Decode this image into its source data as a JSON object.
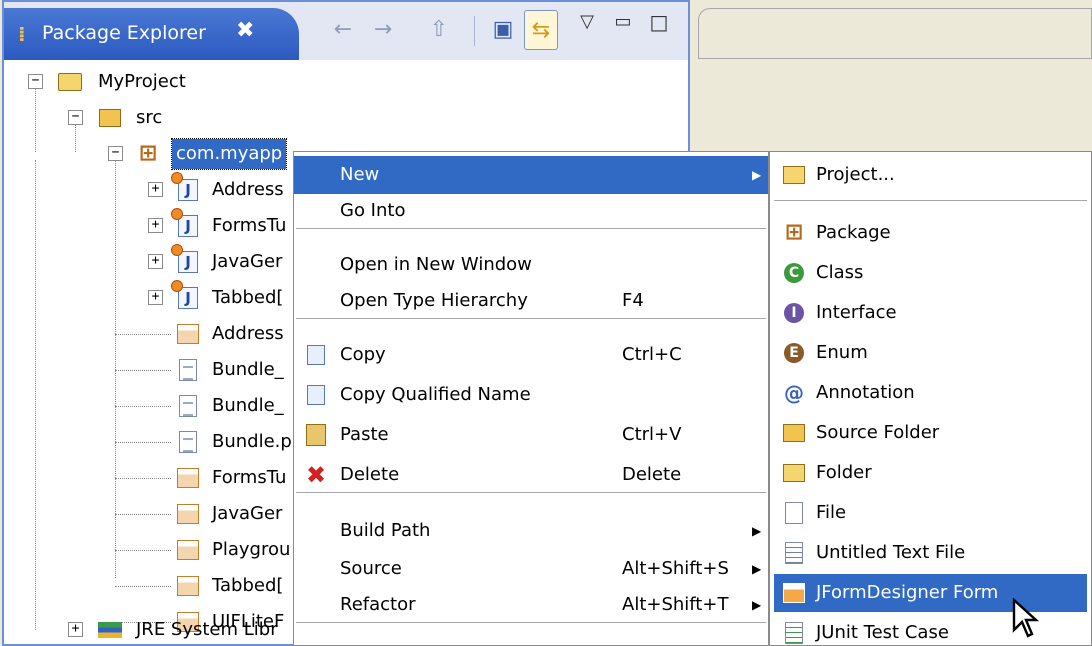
{
  "view": {
    "title": "Package Explorer",
    "close_glyph": "✖",
    "toolbar": {
      "back_icon": "←",
      "forward_icon": "→",
      "up_icon": "⇧",
      "collapse_icon": "▣",
      "link_icon": "⇆",
      "menu_icon": "▽",
      "minimize_icon": "▭",
      "maximize_icon": "□"
    }
  },
  "tree": {
    "project": "MyProject",
    "src": "src",
    "package": "com.myapp",
    "children": [
      {
        "label": "Address",
        "kind": "java",
        "expandable": true
      },
      {
        "label": "FormsTu",
        "kind": "java",
        "expandable": true
      },
      {
        "label": "JavaGer",
        "kind": "java",
        "expandable": true
      },
      {
        "label": "Tabbed[",
        "kind": "java",
        "expandable": true
      },
      {
        "label": "Address",
        "kind": "form",
        "expandable": false
      },
      {
        "label": "Bundle_",
        "kind": "file",
        "expandable": false
      },
      {
        "label": "Bundle_",
        "kind": "file",
        "expandable": false
      },
      {
        "label": "Bundle.p",
        "kind": "file",
        "expandable": false
      },
      {
        "label": "FormsTu",
        "kind": "form",
        "expandable": false
      },
      {
        "label": "JavaGer",
        "kind": "form",
        "expandable": false
      },
      {
        "label": "Playgrou",
        "kind": "form",
        "expandable": false
      },
      {
        "label": "Tabbed[",
        "kind": "form",
        "expandable": false
      },
      {
        "label": "UIFLiteF",
        "kind": "form",
        "expandable": false
      }
    ],
    "jre": "JRE System Libr"
  },
  "context_menu": {
    "items": [
      {
        "label": "New",
        "accel": "",
        "submenu": true,
        "highlighted": true,
        "icon": ""
      },
      {
        "label": "Go Into",
        "accel": "",
        "submenu": false,
        "icon": ""
      },
      {
        "label": "Open in New Window",
        "accel": "",
        "submenu": false,
        "icon": ""
      },
      {
        "label": "Open Type Hierarchy",
        "accel": "F4",
        "submenu": false,
        "icon": ""
      },
      {
        "label": "Copy",
        "accel": "Ctrl+C",
        "submenu": false,
        "icon": "copy-icon"
      },
      {
        "label": "Copy Qualified Name",
        "accel": "",
        "submenu": false,
        "icon": "copy-qualified-icon"
      },
      {
        "label": "Paste",
        "accel": "Ctrl+V",
        "submenu": false,
        "icon": "paste-icon"
      },
      {
        "label": "Delete",
        "accel": "Delete",
        "submenu": false,
        "icon": "delete-icon"
      },
      {
        "label": "Build Path",
        "accel": "",
        "submenu": true,
        "icon": ""
      },
      {
        "label": "Source",
        "accel": "Alt+Shift+S",
        "submenu": true,
        "icon": ""
      },
      {
        "label": "Refactor",
        "accel": "Alt+Shift+T",
        "submenu": true,
        "icon": ""
      }
    ],
    "arrow_glyph": "▶"
  },
  "new_submenu": {
    "items": [
      {
        "label": "Project...",
        "icon": "new-project-icon"
      },
      {
        "label": "Package",
        "icon": "package-icon"
      },
      {
        "label": "Class",
        "icon": "class-icon",
        "glyph": "C"
      },
      {
        "label": "Interface",
        "icon": "interface-icon",
        "glyph": "I"
      },
      {
        "label": "Enum",
        "icon": "enum-icon",
        "glyph": "E"
      },
      {
        "label": "Annotation",
        "icon": "annotation-icon",
        "glyph": "@"
      },
      {
        "label": "Source Folder",
        "icon": "source-folder-icon"
      },
      {
        "label": "Folder",
        "icon": "folder-icon"
      },
      {
        "label": "File",
        "icon": "file-icon"
      },
      {
        "label": "Untitled Text File",
        "icon": "text-file-icon"
      },
      {
        "label": "JFormDesigner Form",
        "icon": "jformdesigner-icon",
        "highlighted": true
      },
      {
        "label": "JUnit Test Case",
        "icon": "junit-icon"
      }
    ]
  },
  "colors": {
    "selection": "#316ac5",
    "tab_active": "#2c5ac0",
    "view_border": "#6b8fd8"
  }
}
